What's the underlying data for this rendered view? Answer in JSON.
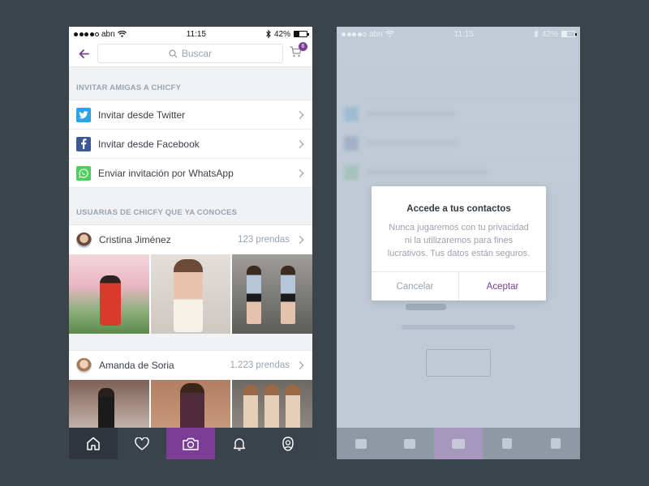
{
  "colors": {
    "background": "#3b434b",
    "accent": "#7b3e94",
    "twitter": "#2aa3ef",
    "facebook": "#3b5998",
    "whatsapp": "#4fce5d",
    "tab_bar": "#3a424b"
  },
  "status_bar": {
    "carrier": "abn",
    "time": "11:15",
    "battery_percent": "42%",
    "battery_level": 0.42
  },
  "nav": {
    "search_placeholder": "Buscar",
    "cart_count": "6"
  },
  "invite_section": {
    "header": "INVITAR AMIGAS A CHICFY",
    "items": [
      {
        "label": "Invitar desde Twitter",
        "icon": "twitter-icon"
      },
      {
        "label": "Invitar desde Facebook",
        "icon": "facebook-icon"
      },
      {
        "label": "Enviar invitación por WhatsApp",
        "icon": "whatsapp-icon"
      }
    ]
  },
  "users_section": {
    "header": "USUARIAS DE CHICFY QUE YA CONOCES",
    "users": [
      {
        "name": "Cristina Jiménez",
        "count": "123 prendas"
      },
      {
        "name": "Amanda de Soria",
        "count": "1.223 prendas"
      }
    ]
  },
  "tabs": [
    {
      "icon": "home-icon"
    },
    {
      "icon": "heart-icon"
    },
    {
      "icon": "camera-icon"
    },
    {
      "icon": "bell-icon"
    },
    {
      "icon": "profile-icon"
    }
  ],
  "dialog": {
    "title": "Accede a tus contactos",
    "body": "Nunca jugaremos con tu privacidad ni la utilizaremos para fines lucrativos. Tus datos están seguros.",
    "cancel": "Cancelar",
    "accept": "Aceptar"
  }
}
